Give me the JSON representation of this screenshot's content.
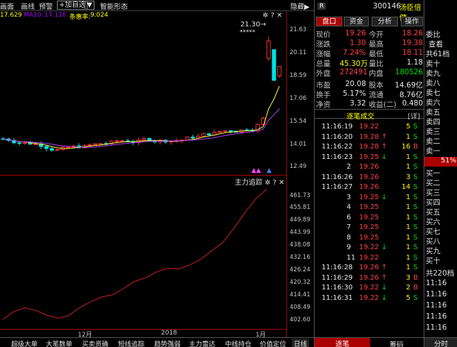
{
  "toolbar": {
    "items": [
      "画面",
      "画线",
      "预警",
      "+加自选",
      "智能形态",
      "隐藏"
    ],
    "dropdown": "▼"
  },
  "infobar": {
    "ma1": "17.629",
    "ma2": "MA10:",
    "ma2v": "17.116",
    "ma_label": "条惠率:",
    "ma_value": "9.024"
  },
  "main_chart": {
    "peak_label": "21.30",
    "stars": "*****",
    "y_ticks": [
      "21.63",
      "20.11",
      "18.59",
      "17.06",
      "15.54",
      "14.01",
      "12.49"
    ]
  },
  "sub_panel": {
    "title": "主力追踪",
    "y_ticks": [
      "461.73",
      "455.81",
      "449.89",
      "443.99",
      "438.08",
      "432.16",
      "426.24",
      "420.32",
      "414.41",
      "408.49",
      "402.60"
    ]
  },
  "x_axis": [
    "12月",
    "2018",
    "1月"
  ],
  "bottom_tabs": [
    "超级大单",
    "大笔数单",
    "买卖资确",
    "短线追踪",
    "趋势强弱",
    "主力雷达",
    "中线持仓",
    "价值定位",
    "日线"
  ],
  "stock": {
    "market": "R",
    "code": "300146",
    "name": "汤臣倍健"
  },
  "right_tabs": [
    "盘口",
    "资金",
    "分析",
    "操作"
  ],
  "quote": [
    {
      "l1": "现价",
      "v1": "19.26",
      "c1": "red",
      "l2": "今开",
      "v2": "18.26",
      "c2": "red"
    },
    {
      "l1": "涨跌",
      "v1": "1.30",
      "c1": "red",
      "l2": "最高",
      "v2": "19.38",
      "c2": "red"
    },
    {
      "l1": "涨幅",
      "v1": "7.24%",
      "c1": "red",
      "l2": "最低",
      "v2": "18.11",
      "c2": "red"
    },
    {
      "l1": "总量",
      "v1": "45.30万",
      "c1": "yel",
      "l2": "量比",
      "v2": "1.18",
      "c2": "wht"
    },
    {
      "l1": "外盘",
      "v1": "272491",
      "c1": "red",
      "l2": "内盘",
      "v2": "180526",
      "c2": "green"
    },
    {
      "l1": "市盈",
      "v1": "20.08",
      "c1": "wht",
      "l2": "股本",
      "v2": "14.69亿",
      "c2": "wht"
    },
    {
      "l1": "换手",
      "v1": "5.17%",
      "c1": "wht",
      "l2": "流通",
      "v2": "8.76亿",
      "c2": "wht"
    },
    {
      "l1": "净资",
      "v1": "3.32",
      "c1": "wht",
      "l2": "收益(二)",
      "v2": "0.480",
      "c2": "wht"
    }
  ],
  "ticks_header": {
    "title": "逐笔成交",
    "detail": "[详]"
  },
  "ticks": [
    {
      "t": "11:16:19",
      "p": "19.22",
      "a": "",
      "v": "5",
      "s": "S"
    },
    {
      "t": "11:16:20",
      "p": "19.28",
      "a": "↑",
      "v": "1",
      "s": "S"
    },
    {
      "t": "11:16:22",
      "p": "19.28",
      "a": "↑",
      "v": "16",
      "s": "B"
    },
    {
      "t": "11:16:23",
      "p": "19.25",
      "a": "↓",
      "v": "1",
      "s": "S"
    },
    {
      "t": "2",
      "p": "19.26",
      "a": "",
      "v": "1",
      "s": "S"
    },
    {
      "t": "11:16:26",
      "p": "19.26",
      "a": "",
      "v": "3",
      "s": "S"
    },
    {
      "t": "11:16:27",
      "p": "19.26",
      "a": "",
      "v": "14",
      "s": "S"
    },
    {
      "t": "3",
      "p": "19.25",
      "a": "↓",
      "v": "1",
      "s": "S"
    },
    {
      "t": "4",
      "p": "19.25",
      "a": "",
      "v": "1",
      "s": "S"
    },
    {
      "t": "6",
      "p": "19.25",
      "a": "",
      "v": "1",
      "s": "S"
    },
    {
      "t": "7",
      "p": "19.25",
      "a": "",
      "v": "1",
      "s": "S"
    },
    {
      "t": "8",
      "p": "19.25",
      "a": "",
      "v": "1",
      "s": "S"
    },
    {
      "t": "9",
      "p": "19.22",
      "a": "↓",
      "v": "1",
      "s": "S"
    },
    {
      "t": "11",
      "p": "19.22",
      "a": "",
      "v": "1",
      "s": "S"
    },
    {
      "t": "11:16:28",
      "p": "19.26",
      "a": "↑",
      "v": "1",
      "s": "S"
    },
    {
      "t": "11:16:29",
      "p": "19.26",
      "a": "↑",
      "v": "3",
      "s": "B"
    },
    {
      "t": "11:16:30",
      "p": "19.22",
      "a": "↓",
      "v": "2",
      "s": "B"
    },
    {
      "t": "11:16:31",
      "p": "19.22",
      "a": "↓",
      "v": "5",
      "s": "S"
    }
  ],
  "ticks_bottom": {
    "a": "逐笔",
    "b": "筹码"
  },
  "orderbook": {
    "top1": "委比",
    "top2": "查看",
    "count": "共61档",
    "sells": [
      "卖十",
      "卖九",
      "卖八",
      "卖七",
      "卖六",
      "卖五",
      "卖四",
      "卖三",
      "卖二",
      "卖一"
    ],
    "ratio": "51%",
    "buys": [
      "买一",
      "买二",
      "买三",
      "买四",
      "买五",
      "买六",
      "买七",
      "买八",
      "买九",
      "买十"
    ],
    "total": "共220档",
    "times": [
      "11:16",
      "11:16",
      "11:16",
      "11:16",
      "11:16"
    ],
    "bottom": "分时"
  }
}
